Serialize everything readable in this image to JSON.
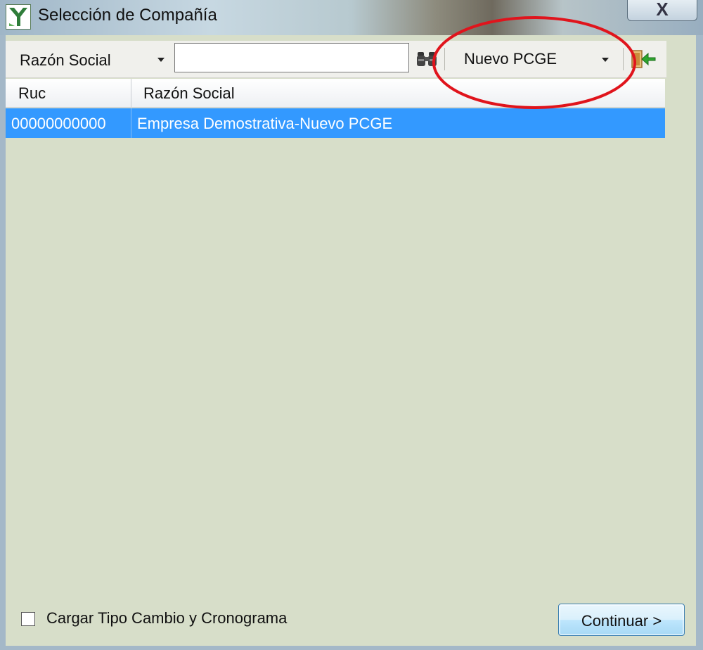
{
  "window": {
    "title": "Selección de Compañía",
    "close_label": "X"
  },
  "toolbar": {
    "search_field_value": "Razón Social",
    "search_input_value": "",
    "plan_value": "Nuevo PCGE"
  },
  "grid": {
    "columns": [
      "Ruc",
      "Razón Social"
    ],
    "rows": [
      {
        "ruc": "00000000000",
        "razon_social": "Empresa Demostrativa-Nuevo PCGE",
        "selected": true
      }
    ]
  },
  "footer": {
    "checkbox_label": "Cargar Tipo Cambio y Cronograma",
    "checkbox_checked": false,
    "continue_label": "Continuar >"
  },
  "colors": {
    "selection": "#3399ff",
    "client_background": "#d7dec9",
    "annotation": "#e0141c"
  },
  "icons": [
    "app-logo-icon",
    "binoculars-icon",
    "exit-arrow-icon",
    "dropdown-arrow-icon"
  ]
}
